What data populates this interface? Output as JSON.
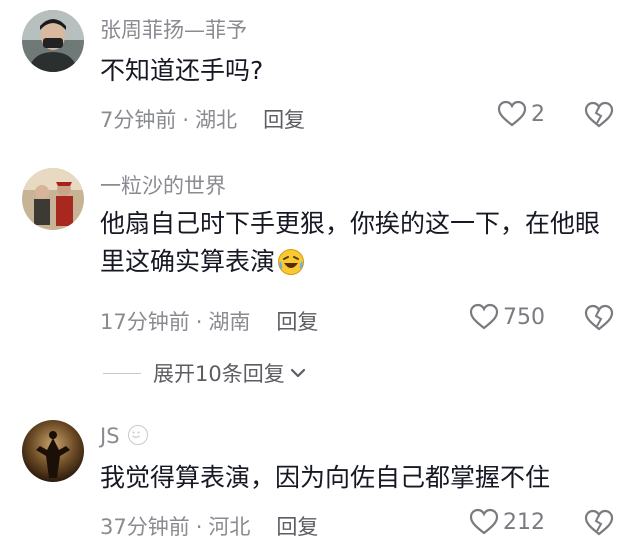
{
  "comments": [
    {
      "username": "张周菲扬—菲予",
      "text": "不知道还手吗?",
      "time": "7分钟前",
      "location": "湖北",
      "reply_label": "回复",
      "likes": "2"
    },
    {
      "username": "一粒沙的世界",
      "text": "他扇自己时下手更狠，你挨的这一下，在他眼里这确实算表演",
      "emoji": "laughing-tears-emoji",
      "time": "17分钟前",
      "location": "湖南",
      "reply_label": "回复",
      "likes": "750"
    },
    {
      "username": "JS",
      "text": "我觉得算表演，因为向佐自己都掌握不住",
      "time": "37分钟前",
      "location": "河北",
      "reply_label": "回复",
      "likes": "212"
    }
  ],
  "expand_replies": {
    "label": "展开10条回复"
  },
  "icons": {
    "like": "heart-outline-icon",
    "dislike": "broken-heart-icon",
    "expand": "chevron-down-icon"
  },
  "colors": {
    "secondary_text": "#8a8b91",
    "primary_text": "#161823"
  }
}
